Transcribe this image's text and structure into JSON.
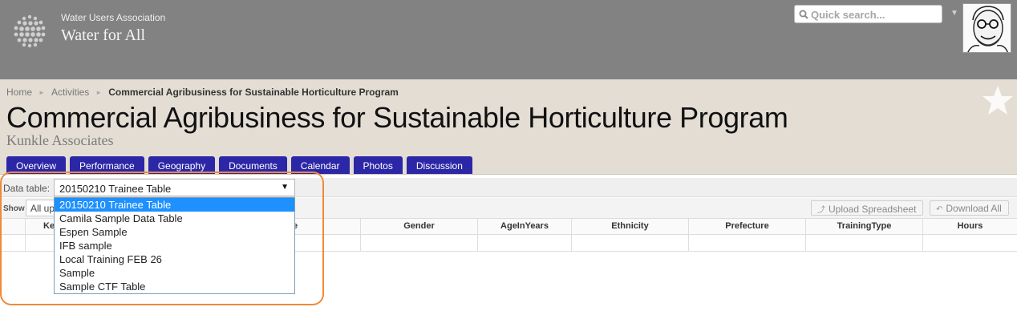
{
  "header": {
    "org_name": "Water Users Association",
    "site_title": "Water for All",
    "search_placeholder": "Quick search...",
    "logo_icon": "globe-dots-icon",
    "avatar_icon": "user-avatar-caricature"
  },
  "breadcrumb": {
    "items": [
      "Home",
      "Activities"
    ],
    "current": "Commercial Agribusiness for Sustainable Horticulture Program"
  },
  "page": {
    "title": "Commercial Agribusiness for Sustainable Horticulture Program",
    "subtitle": "Kunkle Associates",
    "favorite_icon": "star-icon"
  },
  "tabs": [
    "Overview",
    "Performance",
    "Geography",
    "Documents",
    "Calendar",
    "Photos",
    "Discussion"
  ],
  "data_table": {
    "label": "Data table:",
    "selected": "20150210 Trainee Table",
    "options": [
      "20150210 Trainee Table",
      "Camila Sample Data Table",
      "Espen Sample",
      "IFB sample",
      "Local Training FEB 26",
      "Sample",
      "Sample CTF Table"
    ]
  },
  "toolbar": {
    "show_label": "Show",
    "show_value": "All up",
    "upload_label": "Upload Spreadsheet",
    "download_label": "Download All"
  },
  "grid": {
    "columns": [
      "",
      "Ke",
      "e",
      "Gender",
      "AgeInYears",
      "Ethnicity",
      "Prefecture",
      "TrainingType",
      "Hours"
    ]
  },
  "colors": {
    "header_bg": "#838282",
    "band_bg": "#e3ddd4",
    "tab_bg": "#2c27a6",
    "selected_option": "#1e90ff",
    "annotation": "#f08a37"
  }
}
